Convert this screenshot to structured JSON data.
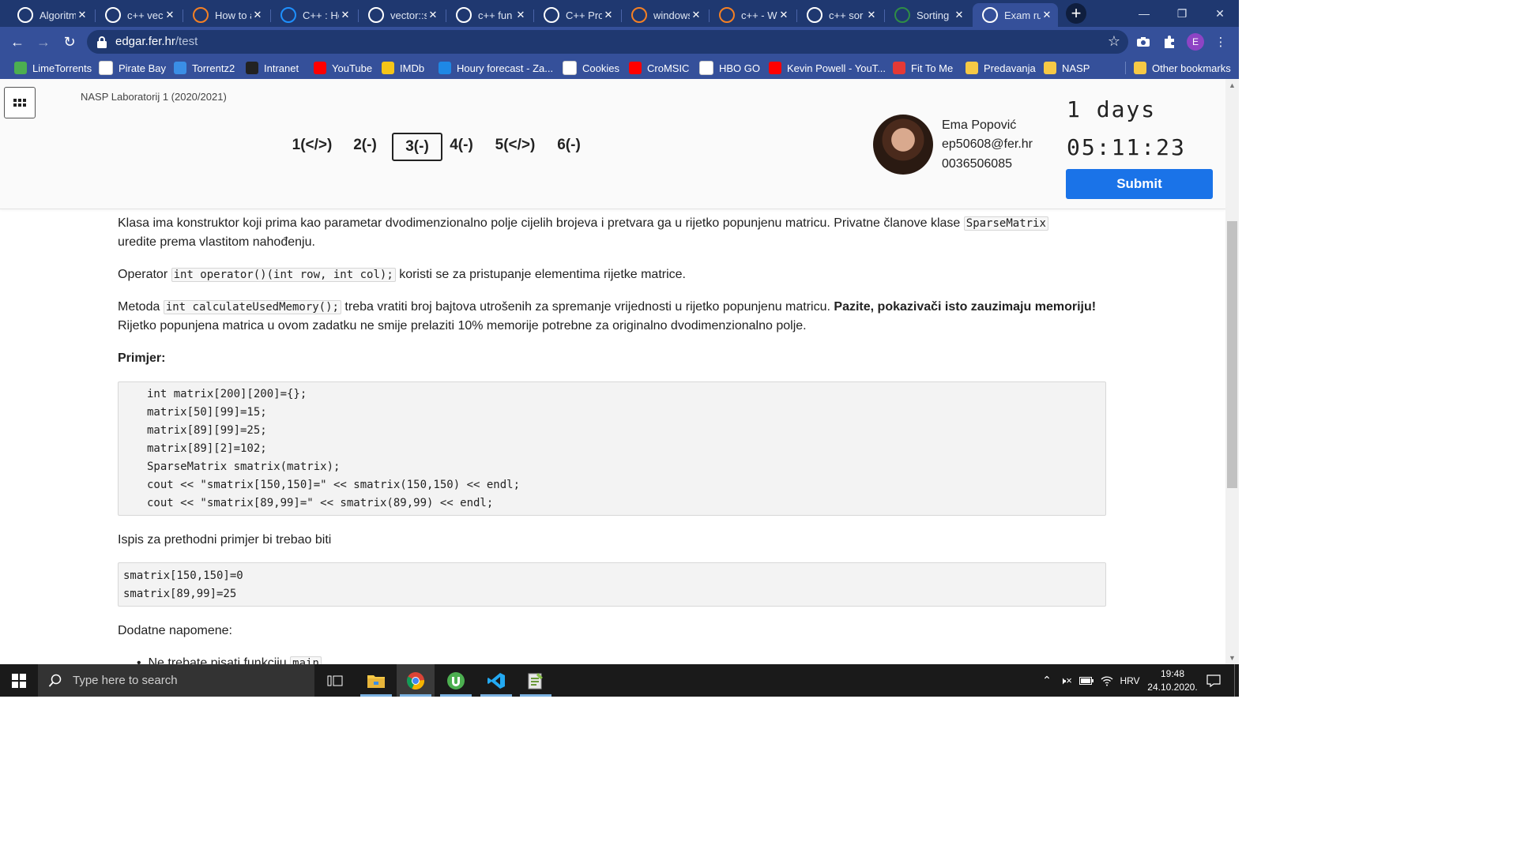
{
  "browser": {
    "tabs": [
      {
        "title": "Algoritm",
        "icon": "github-icon",
        "color": "#ffffff"
      },
      {
        "title": "c++ vec",
        "icon": "google-icon",
        "color": "#ffffff"
      },
      {
        "title": "How to a",
        "icon": "stackoverflow-icon",
        "color": "#f48024"
      },
      {
        "title": "C++ : Ho",
        "icon": "reference-icon",
        "color": "#1e90ff"
      },
      {
        "title": "vector::s",
        "icon": "cplusplus-icon",
        "color": "#ffffff"
      },
      {
        "title": "c++ fun",
        "icon": "google-icon",
        "color": "#ffffff"
      },
      {
        "title": "C++ Pro",
        "icon": "ref-icon",
        "color": "#ffffff"
      },
      {
        "title": "windows",
        "icon": "stackoverflow-icon",
        "color": "#f48024"
      },
      {
        "title": "c++ - W",
        "icon": "stackoverflow-icon",
        "color": "#f48024"
      },
      {
        "title": "c++ sor",
        "icon": "google-icon",
        "color": "#ffffff"
      },
      {
        "title": "Sorting",
        "icon": "geeks-icon",
        "color": "#2f8d46"
      },
      {
        "title": "Exam ru",
        "icon": "exam-icon",
        "color": "#ffffff"
      }
    ],
    "active_tab_index": 11,
    "url_host": "edgar.fer.hr",
    "url_path": "/test",
    "profile_initial": "E"
  },
  "bookmarks": [
    {
      "label": "LimeTorrents",
      "icon": "limetorrents-icon",
      "color": "#4caf50"
    },
    {
      "label": "Pirate Bay",
      "icon": "piratebay-icon",
      "color": "#ffffff"
    },
    {
      "label": "Torrentz2",
      "icon": "torrentz-icon",
      "color": "#3a8ee6"
    },
    {
      "label": "Intranet",
      "icon": "intranet-icon",
      "color": "#222222"
    },
    {
      "label": "YouTube",
      "icon": "youtube-icon",
      "color": "#ff0000"
    },
    {
      "label": "IMDb",
      "icon": "imdb-icon",
      "color": "#f5c518"
    },
    {
      "label": "Houry forecast - Za...",
      "icon": "weather-icon",
      "color": "#1e88e5"
    },
    {
      "label": "Cookies",
      "icon": "gear-icon",
      "color": "#ffffff"
    },
    {
      "label": "CroMSIC",
      "icon": "youtube-icon",
      "color": "#ff0000"
    },
    {
      "label": "HBO GO",
      "icon": "hbo-icon",
      "color": "#ffffff"
    },
    {
      "label": "Kevin Powell - YouT...",
      "icon": "youtube-icon",
      "color": "#ff0000"
    },
    {
      "label": "Fit To Me",
      "icon": "fittome-icon",
      "color": "#e53935"
    },
    {
      "label": "Predavanja",
      "icon": "folder-icon",
      "color": "#f6c945"
    },
    {
      "label": "NASP",
      "icon": "folder-icon",
      "color": "#f6c945"
    }
  ],
  "other_bookmarks": "Other bookmarks",
  "exam": {
    "course": "NASP Laboratorij 1 (2020/2021)",
    "questions": [
      "1(</>)",
      "2(-)",
      "3(-)",
      "4(-)",
      "5(</>)",
      "6(-)"
    ],
    "active_question": 2,
    "user": {
      "name": "Ema Popović",
      "email": "ep50608@fer.hr",
      "jmbag": "0036506085"
    },
    "days_left": "1 days",
    "time_left": "05:11:23",
    "submit_label": "Submit"
  },
  "content": {
    "p1_a": "Klasa ima konstruktor koji prima kao parametar dvodimenzionalno polje cijelih brojeva i pretvara ga u rijetko popunjenu matricu. Privatne članove klase ",
    "p1_code": "SparseMatrix",
    "p1_b": "uredite prema vlastitom nahođenju.",
    "p2_a": "Operator ",
    "p2_code": "int operator()(int row, int col);",
    "p2_b": " koristi se za pristupanje elementima rijetke matrice.",
    "p3_a": "Metoda ",
    "p3_code": "int calculateUsedMemory();",
    "p3_b": " treba vratiti broj bajtova utrošenih za spremanje vrijednosti u rijetko popunjenu matricu. ",
    "p3_bold": "Pazite, pokazivači isto zauzimaju memoriju!",
    "p3_c": "Rijetko popunjena matrica u ovom zadatku ne smije prelaziti 10% memorije potrebne za originalno dvodimenzionalno polje.",
    "example_heading": "Primjer:",
    "example_code": [
      "int matrix[200][200]={};",
      "matrix[50][99]=15;",
      "matrix[89][99]=25;",
      "matrix[89][2]=102;",
      "SparseMatrix smatrix(matrix);",
      "cout << \"smatrix[150,150]=\" << smatrix(150,150) << endl;",
      "cout << \"smatrix[89,99]=\" << smatrix(89,99) << endl;"
    ],
    "output_intro": "Ispis za prethodni primjer bi trebao biti",
    "output_code": [
      "smatrix[150,150]=0",
      "smatrix[89,99]=25"
    ],
    "notes_heading": "Dodatne napomene:",
    "note1_a": "Ne trebate pisati funkciju ",
    "note1_code": "main"
  },
  "taskbar": {
    "search_placeholder": "Type here to search",
    "language": "HRV",
    "time": "19:48",
    "date": "24.10.2020."
  }
}
